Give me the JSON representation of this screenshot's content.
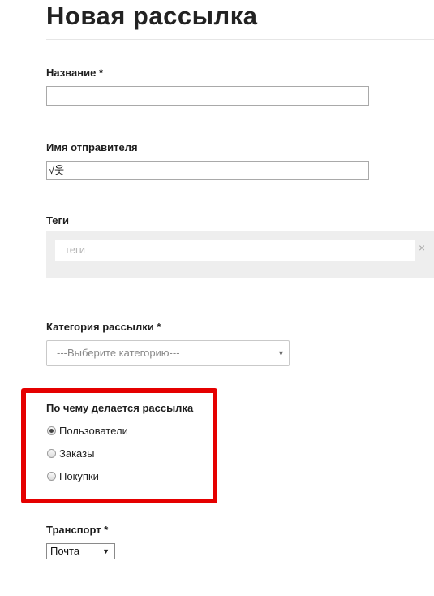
{
  "page": {
    "title": "Новая рассылка"
  },
  "form": {
    "name": {
      "label": "Название *",
      "value": ""
    },
    "sender": {
      "label": "Имя отправителя",
      "value": "√웃"
    },
    "tags": {
      "label": "Теги",
      "placeholder": "теги",
      "clear_icon": "×"
    },
    "category": {
      "label": "Категория рассылки *",
      "selected": "---Выберите категорию---",
      "arrow_icon": "▼"
    },
    "basis": {
      "label": "По чему делается рассылка",
      "options": [
        {
          "label": "Пользователи",
          "checked": true
        },
        {
          "label": "Заказы",
          "checked": false
        },
        {
          "label": "Покупки",
          "checked": false
        }
      ],
      "highlight_color": "#e50000"
    },
    "transport": {
      "label": "Транспорт *",
      "selected": "Почта",
      "arrow_icon": "▼"
    }
  }
}
